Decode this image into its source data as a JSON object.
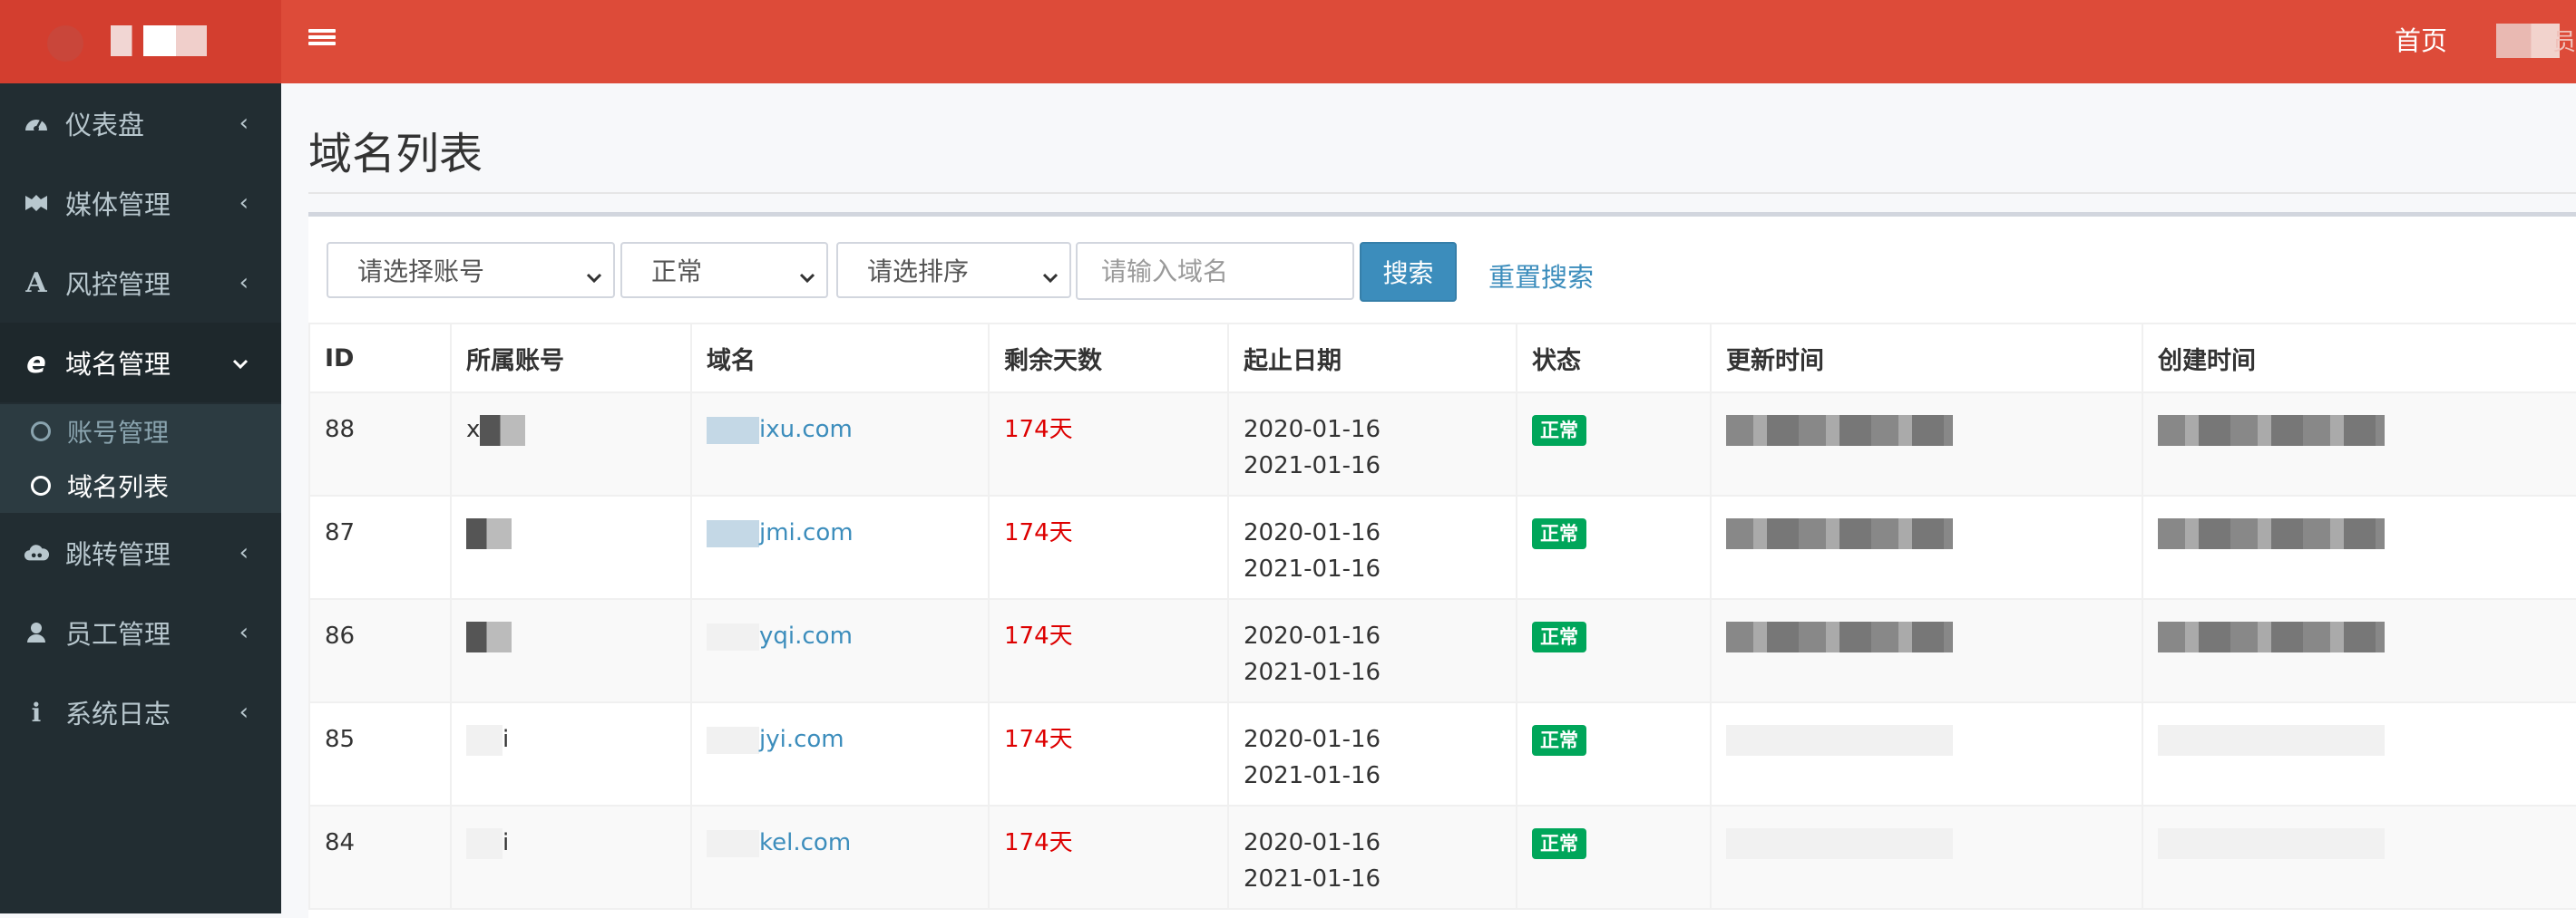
{
  "sidebar": {
    "menu": [
      {
        "label": "仪表盘",
        "icon": "dashboard-icon"
      },
      {
        "label": "媒体管理",
        "icon": "media-icon"
      },
      {
        "label": "风控管理",
        "icon": "font-icon"
      },
      {
        "label": "域名管理",
        "icon": "ie-icon"
      },
      {
        "label": "跳转管理",
        "icon": "cloud-icon"
      },
      {
        "label": "员工管理",
        "icon": "user-icon"
      },
      {
        "label": "系统日志",
        "icon": "info-icon"
      }
    ],
    "submenu": [
      {
        "label": "账号管理"
      },
      {
        "label": "域名列表"
      }
    ]
  },
  "header": {
    "home": "首页",
    "user_glyph": "员"
  },
  "page": {
    "title": "域名列表"
  },
  "filters": {
    "account_select": "请选择账号",
    "status_select": "正常",
    "sort_select": "请选排序",
    "domain_placeholder": "请输入域名",
    "search_label": "搜索",
    "reset_label": "重置搜索"
  },
  "table": {
    "headers": [
      "ID",
      "所属账号",
      "域名",
      "剩余天数",
      "起止日期",
      "状态",
      "更新时间",
      "创建时间"
    ],
    "rows": [
      {
        "id": "88",
        "account": "x",
        "domain": "ixu.com",
        "days": "174天",
        "start": "2020-01-16",
        "end": "2021-01-16",
        "status": "正常"
      },
      {
        "id": "87",
        "account": "",
        "domain": "jmi.com",
        "days": "174天",
        "start": "2020-01-16",
        "end": "2021-01-16",
        "status": "正常"
      },
      {
        "id": "86",
        "account": "",
        "domain": "yqi.com",
        "days": "174天",
        "start": "2020-01-16",
        "end": "2021-01-16",
        "status": "正常"
      },
      {
        "id": "85",
        "account": "i",
        "domain": "jyi.com",
        "days": "174天",
        "start": "2020-01-16",
        "end": "2021-01-16",
        "status": "正常"
      },
      {
        "id": "84",
        "account": "i",
        "domain": "kel.com",
        "days": "174天",
        "start": "2020-01-16",
        "end": "2021-01-16",
        "status": "正常"
      }
    ]
  },
  "colors": {
    "header": "#dd4b39",
    "logo": "#d33e2f",
    "sidebar": "#222d32",
    "link": "#3c8dbc",
    "badge": "#00a65a",
    "days": "#dd0000"
  }
}
